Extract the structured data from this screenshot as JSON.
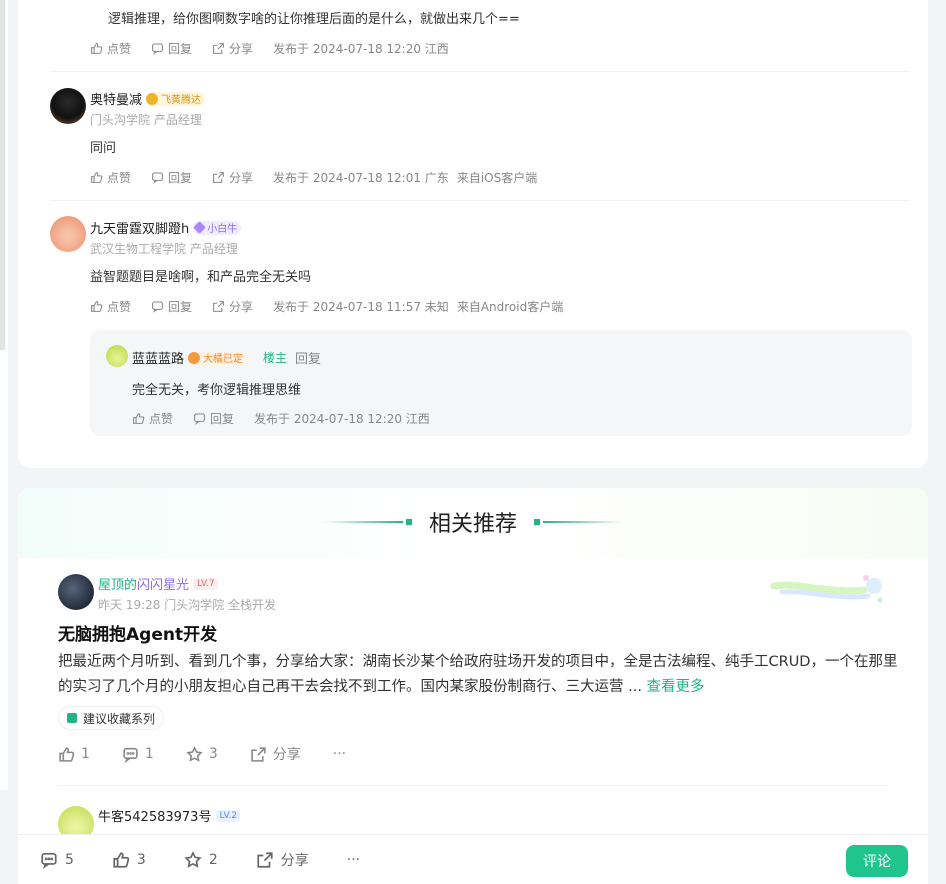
{
  "top_cut_text": "逻辑推理，给你图啊数字啥的让你推理后面的是什么，就做出来几个==",
  "labels": {
    "like": "点赞",
    "reply": "回复",
    "share": "分享"
  },
  "comments": [
    {
      "meta": "发布于 2024-07-18 12:20 江西",
      "client": ""
    },
    {
      "name": "奥特曼减",
      "badge": "飞黄腾达",
      "sub": "门头沟学院 产品经理",
      "text": "同问",
      "meta": "发布于 2024-07-18 12:01 广东",
      "client": "来自iOS客户端"
    },
    {
      "name": "九天雷霆双脚蹬h",
      "badge": "小白牛",
      "sub": "武汉生物工程学院 产品经理",
      "text": "益智题题目是啥啊，和产品完全无关吗",
      "meta": "发布于 2024-07-18 11:57 未知",
      "client": "来自Android客户端"
    }
  ],
  "reply": {
    "name": "蓝蓝蓝路",
    "badge": "大橘已定",
    "owner": "楼主",
    "reply_label": "回复",
    "text": "完全无关，考你逻辑推理思维",
    "meta": "发布于 2024-07-18 12:20 江西"
  },
  "reco": {
    "title": "相关推荐",
    "post": {
      "author_a": "屋顶的",
      "author_b": "闪闪星光",
      "level": "LV.7",
      "sub": "昨天 19:28  门头沟学院 全栈开发",
      "title": "无脑拥抱Agent开发",
      "body": "把最近两个月听到、看到几个事，分享给大家：湖南长沙某个给政府驻场开发的项目中，全是古法编程、纯手工CRUD，一个在那里的实习了几个月的小朋友担心自己再干去会找不到工作。国内某家股份制商行、三大运营 ...",
      "more": "查看更多",
      "tag": "建议收藏系列",
      "likes": "1",
      "comments": "1",
      "stars": "3",
      "share": "分享",
      "more_icon": "···"
    },
    "post2": {
      "author": "牛客542583973号",
      "level": "LV.2"
    }
  },
  "bottom": {
    "comments": "5",
    "likes": "3",
    "stars": "2",
    "share": "分享",
    "more": "···",
    "comment_btn": "评论"
  }
}
